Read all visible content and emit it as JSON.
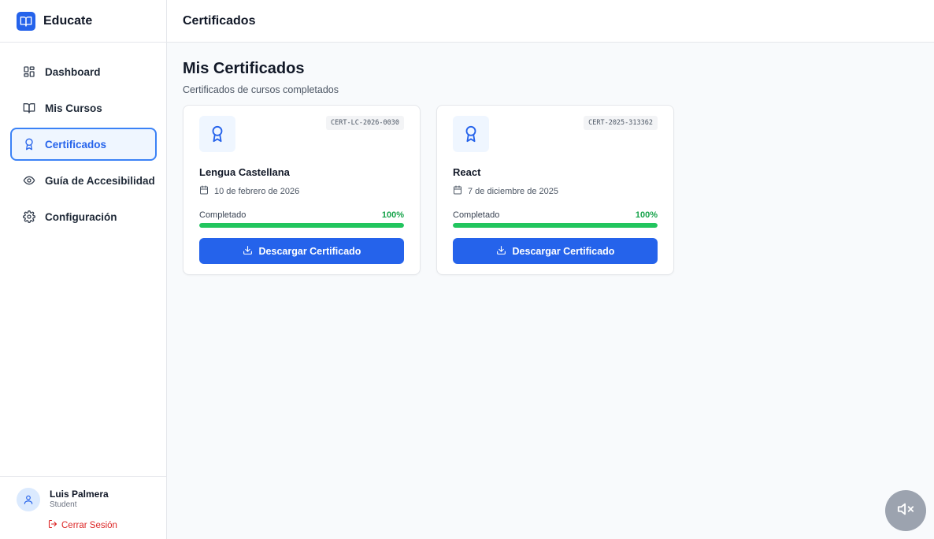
{
  "brand": {
    "name": "Educate",
    "icon": "book-open-icon"
  },
  "sidebar": {
    "items": [
      {
        "label": "Dashboard",
        "icon": "layout-grid-icon",
        "active": false
      },
      {
        "label": "Mis Cursos",
        "icon": "book-open-icon",
        "active": false
      },
      {
        "label": "Certificados",
        "icon": "award-icon",
        "active": true
      },
      {
        "label": "Guía de Accesibilidad",
        "icon": "eye-icon",
        "active": false
      },
      {
        "label": "Configuración",
        "icon": "gear-icon",
        "active": false
      }
    ]
  },
  "user": {
    "name": "Luis Palmera",
    "role": "Student",
    "logout_label": "Cerrar Sesión"
  },
  "header": {
    "title": "Certificados"
  },
  "main": {
    "title": "Mis Certificados",
    "subtitle": "Certificados de cursos completados",
    "certificates": [
      {
        "code": "CERT-LC-2026-0030",
        "course": "Lengua Castellana",
        "date": "10 de febrero de 2026",
        "status_label": "Completado",
        "progress_label": "100%",
        "progress": 1.0,
        "button_label": "Descargar Certificado"
      },
      {
        "code": "CERT-2025-313362",
        "course": "React",
        "date": "7 de diciembre de 2025",
        "status_label": "Completado",
        "progress_label": "100%",
        "progress": 1.0,
        "button_label": "Descargar Certificado"
      }
    ]
  },
  "colors": {
    "accent": "#2563eb",
    "active_bg": "#eff6ff",
    "success": "#22c55e",
    "danger": "#dc2626",
    "mute_button": "#9ca3af"
  },
  "floating": {
    "icon": "volume-mute-icon"
  }
}
